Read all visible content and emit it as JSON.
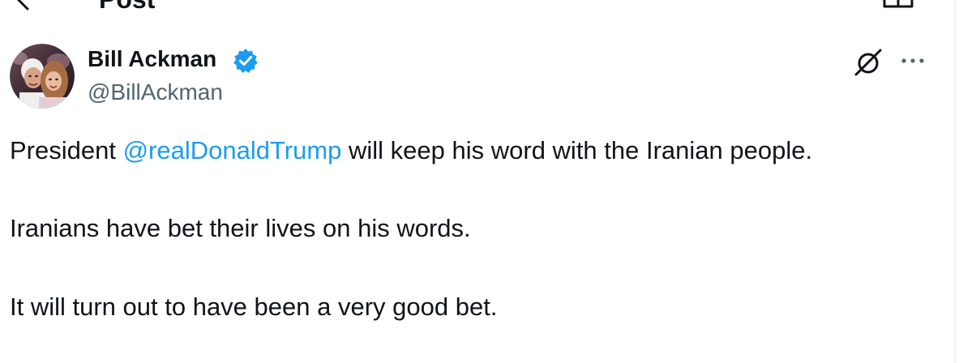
{
  "header": {
    "title": "Post"
  },
  "author": {
    "name": "Bill Ackman",
    "handle": "@BillAckman",
    "verified": true
  },
  "tweet": {
    "line1_before": "President ",
    "line1_mention": "@realDonaldTrump",
    "line1_after": " will keep his word with the Iranian people.",
    "line2": "Iranians have bet their lives on his words.",
    "line3": "It will turn out to have been a very good bet."
  },
  "icons": {
    "back": "back-arrow-icon",
    "reader": "reader-view-icon",
    "verified": "verified-badge-icon",
    "grok": "grok-icon",
    "more": "more-options-icon"
  },
  "colors": {
    "text": "#0f1419",
    "secondary_text": "#536471",
    "link": "#1d9bf0",
    "verified_badge": "#1d9bf0",
    "background": "#ffffff"
  }
}
